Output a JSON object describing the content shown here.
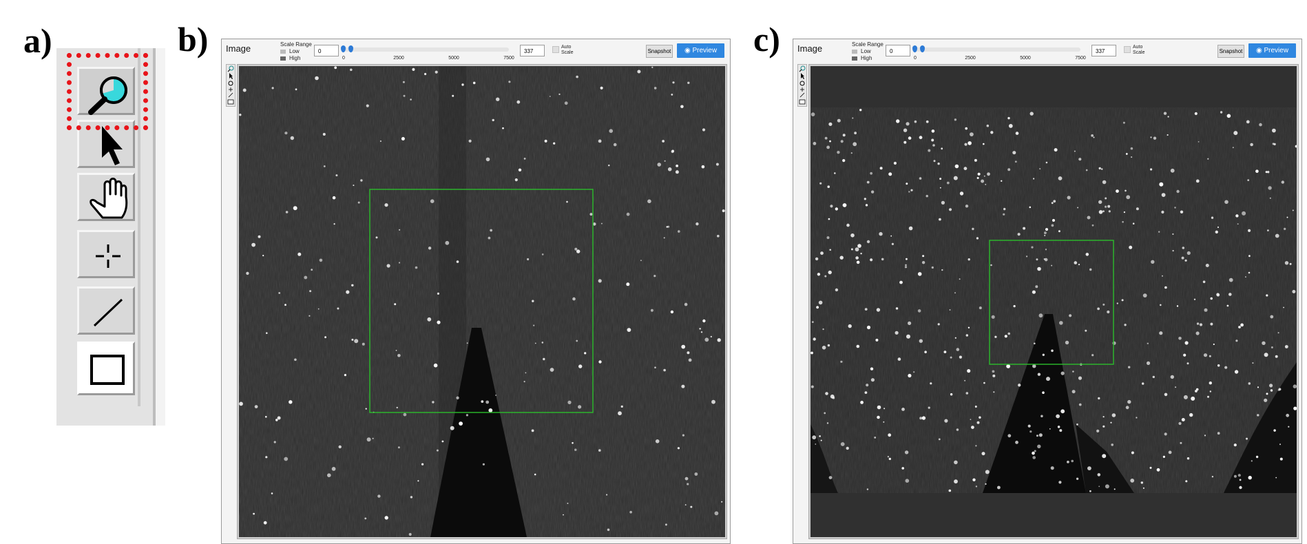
{
  "labels": {
    "a": "a)",
    "b": "b)",
    "c": "c)"
  },
  "toolbar_zoom": {
    "tools": [
      "zoom-tool",
      "pointer-tool",
      "pan-tool",
      "crosshair-tool",
      "line-tool",
      "rectangle-tool"
    ],
    "active_tool": "zoom-tool",
    "highlight_color": "#e8141a"
  },
  "viewer": {
    "image_title": "Image",
    "scale_range_label": "Scale Range",
    "low_label": "Low",
    "high_label": "High",
    "min_value": "0",
    "max_value": "337",
    "ticks": [
      "0",
      "2500",
      "5000",
      "7500"
    ],
    "auto_scale_line1": "Auto",
    "auto_scale_line2": "Scale",
    "snapshot_label": "Snapshot",
    "preview_label": "Preview",
    "accent_color": "#2f87e0",
    "roi_color": "#2bbd2b"
  },
  "panels": {
    "b": {
      "slider_low_fraction": 0.0,
      "slider_high_fraction": 0.045
    },
    "c": {
      "slider_low_fraction": 0.0,
      "slider_high_fraction": 0.045
    }
  }
}
